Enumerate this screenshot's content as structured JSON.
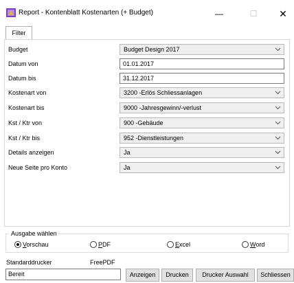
{
  "window": {
    "title": "Report - Kontenblatt Kostenarten (+ Budget)",
    "minimize": "—",
    "maximize": "☐",
    "close": "✕"
  },
  "tabs": [
    {
      "label": "Filter"
    }
  ],
  "filter": {
    "budget": {
      "label": "Budget",
      "value": "Budget Design 2017"
    },
    "datum_von": {
      "label": "Datum von",
      "value": "01.01.2017"
    },
    "datum_bis": {
      "label": "Datum bis",
      "value": "31.12.2017"
    },
    "kostenart_von": {
      "label": "Kostenart von",
      "value": "3200 -Erlös Schliessanlagen"
    },
    "kostenart_bis": {
      "label": "Kostenart bis",
      "value": "9000 -Jahresgewinn/-verlust"
    },
    "kst_von": {
      "label": "Kst / Ktr von",
      "value": "900 -Gebäude"
    },
    "kst_bis": {
      "label": "Kst / Ktr bis",
      "value": "952 -Dienstleistungen"
    },
    "details": {
      "label": "Details anzeigen",
      "value": "Ja"
    },
    "neue_seite": {
      "label": "Neue Seite pro Konto",
      "value": "Ja"
    }
  },
  "output": {
    "title": "Ausgabe wählen",
    "options": [
      {
        "first": "V",
        "rest": "orschau",
        "selected": true
      },
      {
        "first": "P",
        "rest": "DF",
        "selected": false
      },
      {
        "first": "E",
        "rest": "xcel",
        "selected": false
      },
      {
        "first": "W",
        "rest": "ord",
        "selected": false
      }
    ]
  },
  "printer": {
    "label": "Standarddrucker",
    "value": "FreePDF"
  },
  "status": "Bereit",
  "buttons": {
    "anzeigen": "Anzeigen",
    "drucken": "Drucken",
    "drucker_auswahl": "Drucker Auswahl",
    "schliessen": "Schliessen"
  },
  "colors": {
    "app_icon": "#7a3fc4",
    "accent": "#0078d7"
  }
}
